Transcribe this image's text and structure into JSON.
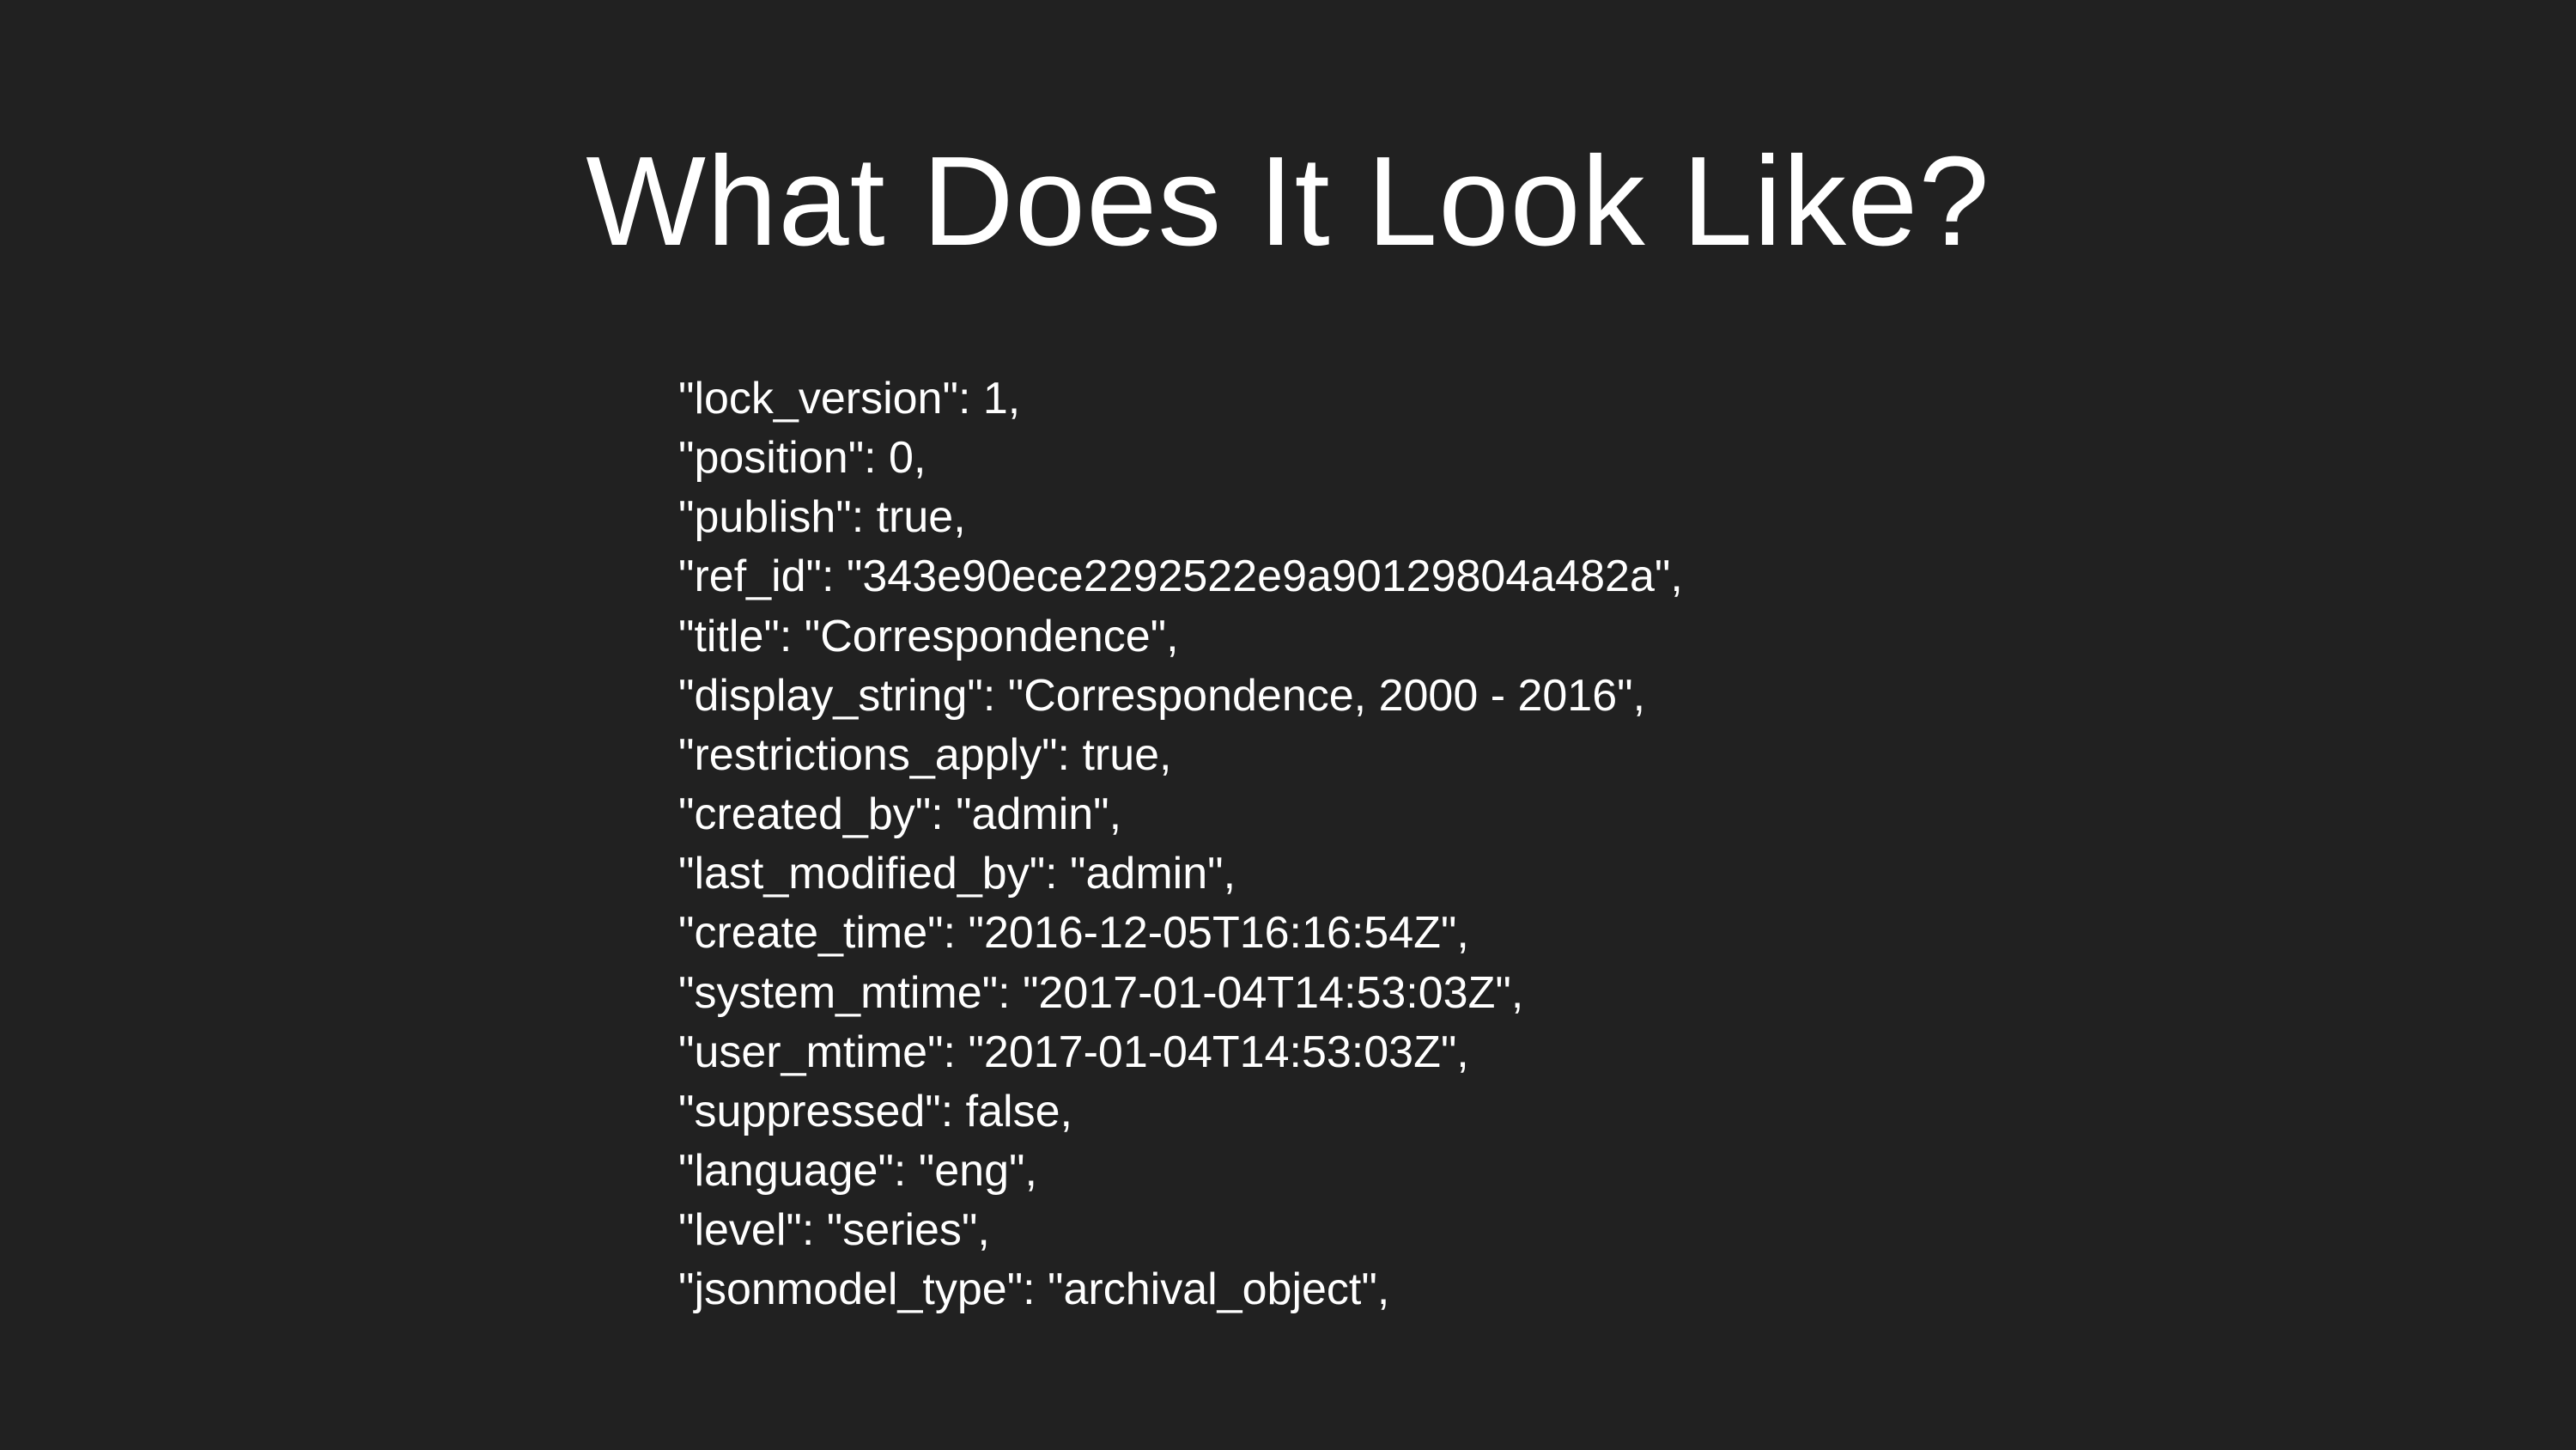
{
  "slide": {
    "title": "What Does It Look Like?",
    "lines": [
      "\"lock_version\": 1,",
      "\"position\": 0,",
      "\"publish\": true,",
      "\"ref_id\": \"343e90ece2292522e9a90129804a482a\",",
      "\"title\": \"Correspondence\",",
      "\"display_string\": \"Correspondence, 2000 - 2016\",",
      "\"restrictions_apply\": true,",
      "\"created_by\": \"admin\",",
      "\"last_modified_by\": \"admin\",",
      "\"create_time\": \"2016-12-05T16:16:54Z\",",
      "\"system_mtime\": \"2017-01-04T14:53:03Z\",",
      "\"user_mtime\": \"2017-01-04T14:53:03Z\",",
      "\"suppressed\": false,",
      "\"language\": \"eng\",",
      "\"level\": \"series\",",
      "\"jsonmodel_type\": \"archival_object\","
    ]
  }
}
